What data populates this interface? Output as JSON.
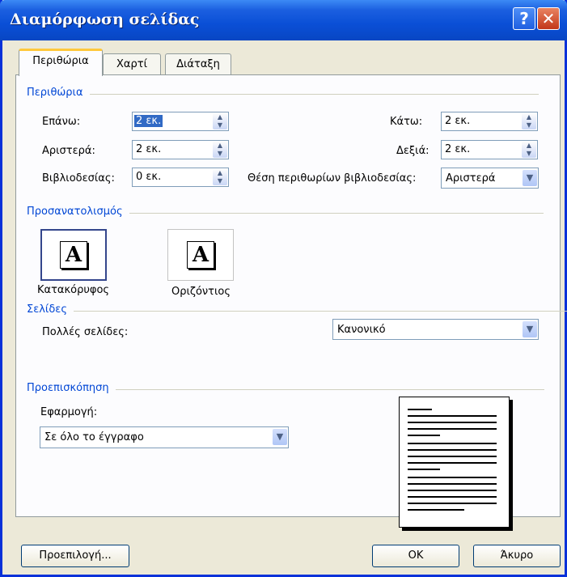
{
  "window": {
    "title": "Διαμόρφωση σελίδας",
    "help_glyph": "?",
    "close_glyph": "✕"
  },
  "tabs": [
    {
      "label": "Περιθώρια",
      "active": true
    },
    {
      "label": "Χαρτί",
      "active": false
    },
    {
      "label": "Διάταξη",
      "active": false
    }
  ],
  "margins": {
    "group_label": "Περιθώρια",
    "top": {
      "label": "Επάνω:",
      "value": "2 εκ."
    },
    "bottom": {
      "label": "Κάτω:",
      "value": "2 εκ."
    },
    "left": {
      "label": "Αριστερά:",
      "value": "2 εκ."
    },
    "right": {
      "label": "Δεξιά:",
      "value": "2 εκ."
    },
    "gutter": {
      "label": "Βιβλιοδεσίας:",
      "value": "0 εκ."
    },
    "gutter_position": {
      "label": "Θέση περιθωρίων βιβλιοδεσίας:",
      "value": "Αριστερά"
    }
  },
  "orientation": {
    "group_label": "Προσανατολισμός",
    "portrait": {
      "label": "Κατακόρυφος",
      "glyph": "A",
      "selected": true
    },
    "landscape": {
      "label": "Οριζόντιος",
      "glyph": "A",
      "selected": false
    }
  },
  "pages": {
    "group_label": "Σελίδες",
    "multiple_label": "Πολλές σελίδες:",
    "multiple_value": "Κανονικό"
  },
  "preview": {
    "group_label": "Προεπισκόπηση",
    "apply_label": "Εφαρμογή:",
    "apply_value": "Σε όλο το έγγραφο"
  },
  "buttons": {
    "default": "Προεπιλογή...",
    "ok": "OK",
    "cancel": "Άκυρο"
  },
  "colors": {
    "titlebar": "#0a4fd6",
    "group_label": "#0046d5",
    "dialog_bg": "#ece9d8"
  }
}
